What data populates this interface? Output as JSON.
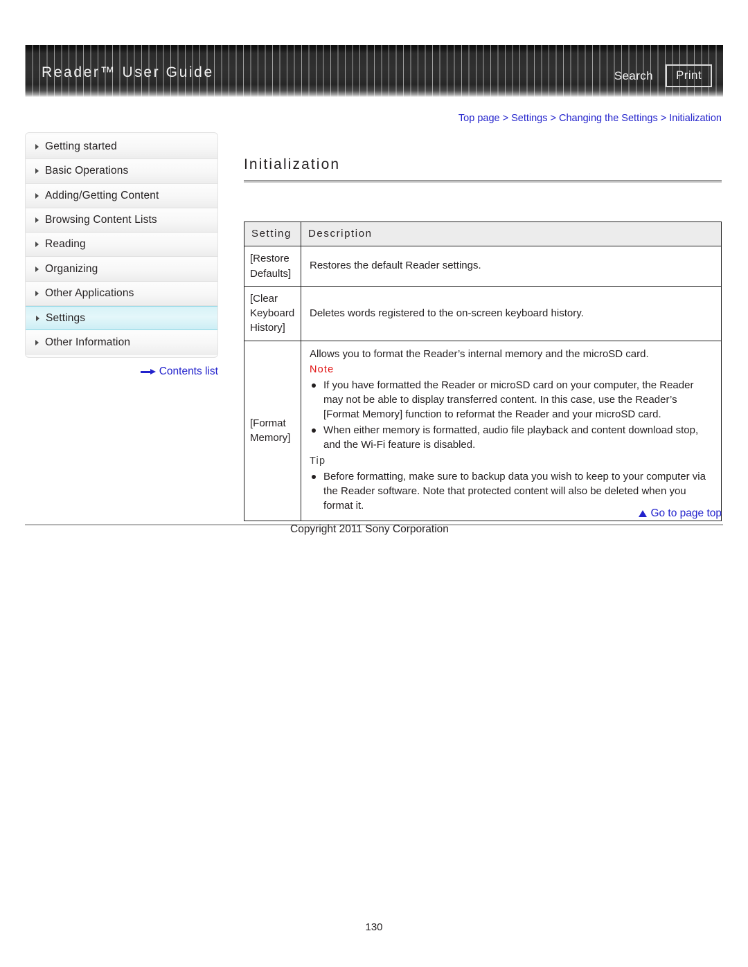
{
  "header": {
    "title": "Reader™ User Guide",
    "search_label": "Search",
    "print_label": "Print"
  },
  "breadcrumb": {
    "text": "Top page > Settings > Changing the Settings > Initialization"
  },
  "sidebar": {
    "items": [
      {
        "label": "Getting started",
        "active": false
      },
      {
        "label": "Basic Operations",
        "active": false
      },
      {
        "label": "Adding/Getting Content",
        "active": false
      },
      {
        "label": "Browsing Content Lists",
        "active": false
      },
      {
        "label": "Reading",
        "active": false
      },
      {
        "label": "Organizing",
        "active": false
      },
      {
        "label": "Other Applications",
        "active": false
      },
      {
        "label": "Settings",
        "active": true
      },
      {
        "label": "Other Information",
        "active": false
      }
    ],
    "contents_list_label": "Contents list"
  },
  "main": {
    "title": "Initialization",
    "table": {
      "headers": [
        "Setting",
        "Description"
      ],
      "rows": [
        {
          "setting": "[Restore Defaults]",
          "description": "Restores the default Reader settings."
        },
        {
          "setting": "[Clear Keyboard History]",
          "description": "Deletes words registered to the on-screen keyboard history."
        },
        {
          "setting": "[Format Memory]",
          "intro": "Allows you to format the Reader’s internal memory and the microSD card.",
          "note_label": "Note",
          "note_items": [
            "If you have formatted the Reader or microSD card on your computer, the Reader may not be able to display transferred content. In this case, use the Reader’s [Format Memory] function to reformat the Reader and your microSD card.",
            "When either memory is formatted, audio file playback and content download stop, and the Wi-Fi feature is disabled."
          ],
          "tip_label": "Tip",
          "tip_items": [
            "Before formatting, make sure to backup data you wish to keep to your computer via the Reader software. Note that protected content will also be deleted when you format it."
          ]
        }
      ]
    }
  },
  "footer": {
    "go_top_label": "Go to page top",
    "copyright": "Copyright 2011 Sony Corporation",
    "page_number": "130"
  },
  "colors": {
    "link_blue": "#2222cc",
    "note_red": "#e01010",
    "active_nav": "#cdeef5",
    "header_dark": "#2e2e2e"
  }
}
